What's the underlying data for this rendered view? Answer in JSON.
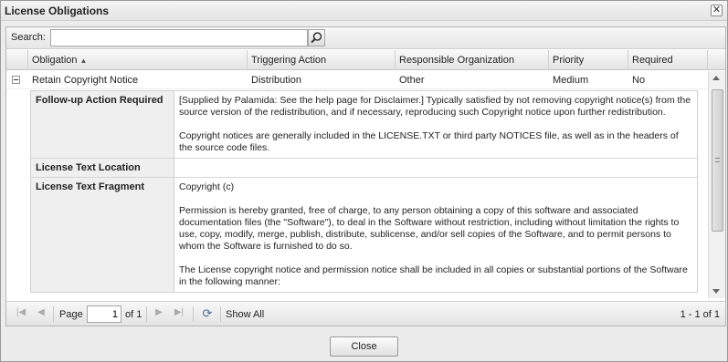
{
  "dialog": {
    "title": "License Obligations"
  },
  "search": {
    "label": "Search:",
    "value": "",
    "placeholder": ""
  },
  "grid": {
    "columns": [
      "Obligation",
      "Triggering Action",
      "Responsible Organization",
      "Priority",
      "Required"
    ],
    "sort": {
      "column": "Obligation",
      "direction": "ascending"
    },
    "rows": [
      {
        "obligation": "Retain Copyright Notice",
        "triggering_action": "Distribution",
        "responsible_org": "Other",
        "priority": "Medium",
        "required": "No",
        "expanded": true
      }
    ],
    "detail": [
      {
        "label": "Follow-up Action Required",
        "paragraphs": [
          "[Supplied by Palamida: See the help page for Disclaimer.] Typically satisfied by not removing copyright notice(s) from the source version of the redistribution, and if necessary, reproducing such Copyright notice upon further redistribution.",
          "Copyright notices are generally included in the LICENSE.TXT or third party NOTICES file, as well as in the headers of the source code files."
        ]
      },
      {
        "label": "License Text Location",
        "paragraphs": []
      },
      {
        "label": "License Text Fragment",
        "paragraphs": [
          "Copyright (c)",
          "Permission is hereby granted, free of charge, to any person obtaining a copy of this software and associated documentation files (the \"Software\"), to deal in the Software without restriction, including without limitation the rights to use, copy, modify, merge, publish, distribute, sublicense, and/or sell copies of the Software, and to permit persons to whom the Software is furnished to do so.",
          "The License copyright notice and permission notice shall be included in all copies or substantial portions of the Software in the following manner:"
        ]
      }
    ]
  },
  "pager": {
    "page_label": "Page",
    "page_value": "1",
    "of_label": "of 1",
    "show_all": "Show All",
    "summary": "1 - 1 of 1"
  },
  "footer": {
    "close_label": "Close"
  },
  "icons": {
    "close": "close-icon",
    "search": "search-icon",
    "expand": "collapse-icon",
    "first": "first-page-icon",
    "prev": "prev-page-icon",
    "next": "next-page-icon",
    "last": "last-page-icon",
    "refresh": "refresh-icon"
  }
}
